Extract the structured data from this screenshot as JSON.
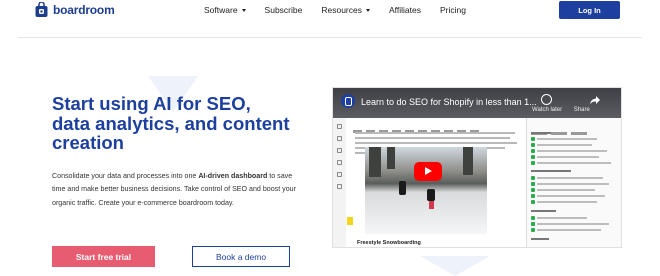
{
  "nav": {
    "logo_text": "boardroom",
    "links": [
      {
        "label": "Software",
        "caret": true
      },
      {
        "label": "Subscribe",
        "caret": false
      },
      {
        "label": "Resources",
        "caret": true
      },
      {
        "label": "Affiliates",
        "caret": false
      },
      {
        "label": "Pricing",
        "caret": false
      }
    ],
    "login_label": "Log In"
  },
  "hero": {
    "title": "Start using AI for SEO, data analytics, and content creation",
    "text_before": "Consolidate your data and processes into one ",
    "text_bold": "AI-driven dashboard",
    "text_after": " to save time and make better business decisions. Take control of SEO and boost your organic traffic. Create your e-commerce boardroom today.",
    "cta_primary": "Start free trial",
    "cta_secondary": "Book a demo"
  },
  "video": {
    "title": "Learn to do SEO for Shopify in less than 1...",
    "meta_left": "Watch later",
    "meta_right": "Share",
    "caption": "Freestyle Snowboarding"
  },
  "colors": {
    "brand_blue": "#1d3f9e",
    "cta_pink": "#e85c72",
    "login_blue": "#1d3fa0",
    "youtube_red": "#ff0000"
  },
  "icons": {
    "logo": "boardroom-bag-icon",
    "dropdown": "caret-down-icon",
    "play": "youtube-play-icon",
    "watch_later": "clock-icon",
    "share": "share-arrow-icon"
  }
}
